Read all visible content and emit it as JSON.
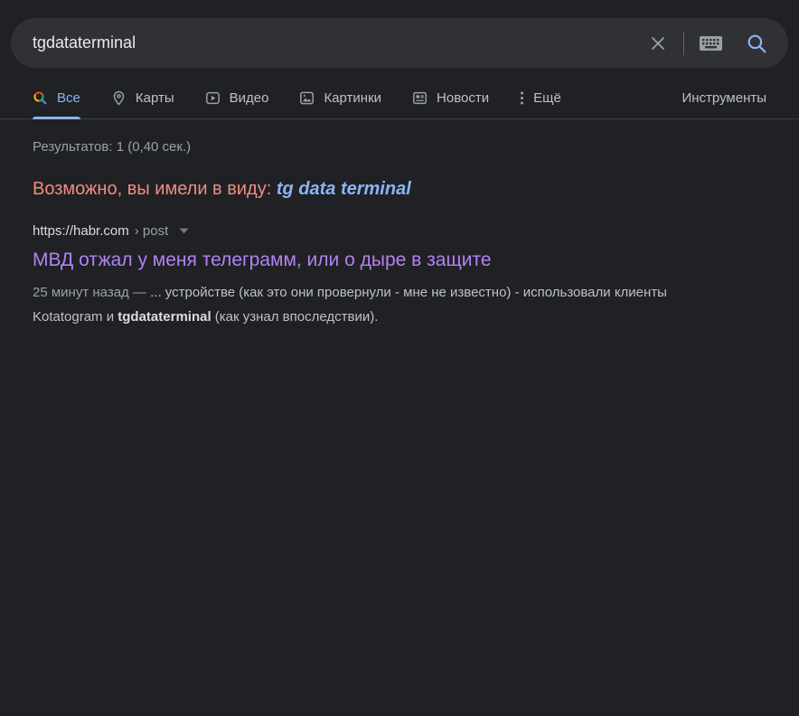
{
  "colors": {
    "page_bg": "#202124",
    "searchbar_bg": "#303134",
    "accent_blue": "#8ab4f8",
    "did_you_mean_red": "#f28b82",
    "visited_link_purple": "#b382f2",
    "divider": "#3c4043"
  },
  "search": {
    "query": "tgdataterminal",
    "clear_icon": "✕",
    "keyboard_icon": "keyboard",
    "submit_icon": "magnifier"
  },
  "tabs": {
    "items": [
      {
        "label": "Все",
        "icon": "google-search-icon",
        "active": true
      },
      {
        "label": "Карты",
        "icon": "map-pin-icon",
        "active": false
      },
      {
        "label": "Видео",
        "icon": "video-play-icon",
        "active": false
      },
      {
        "label": "Картинки",
        "icon": "image-icon",
        "active": false
      },
      {
        "label": "Новости",
        "icon": "news-icon",
        "active": false
      },
      {
        "label": "Ещё",
        "icon": "more-vertical-icon",
        "active": false
      }
    ],
    "tools_label": "Инструменты"
  },
  "results": {
    "stats": "Результатов: 1 (0,40 сек.)",
    "did_you_mean": {
      "prefix": "Возможно, вы имели в виду: ",
      "suggestion": "tg data terminal"
    },
    "items": [
      {
        "url": "https://habr.com",
        "breadcrumb": "› post",
        "title": "МВД отжал у меня телеграмм, или о дыре в защите",
        "snippet": {
          "date": "25 минут назад — ",
          "before": "... устройстве (как это они провернули - мне не известно) - использовали клиенты Kotatogram и ",
          "highlight": "tgdataterminal",
          "after": " (как узнал впоследствии)."
        }
      }
    ]
  }
}
